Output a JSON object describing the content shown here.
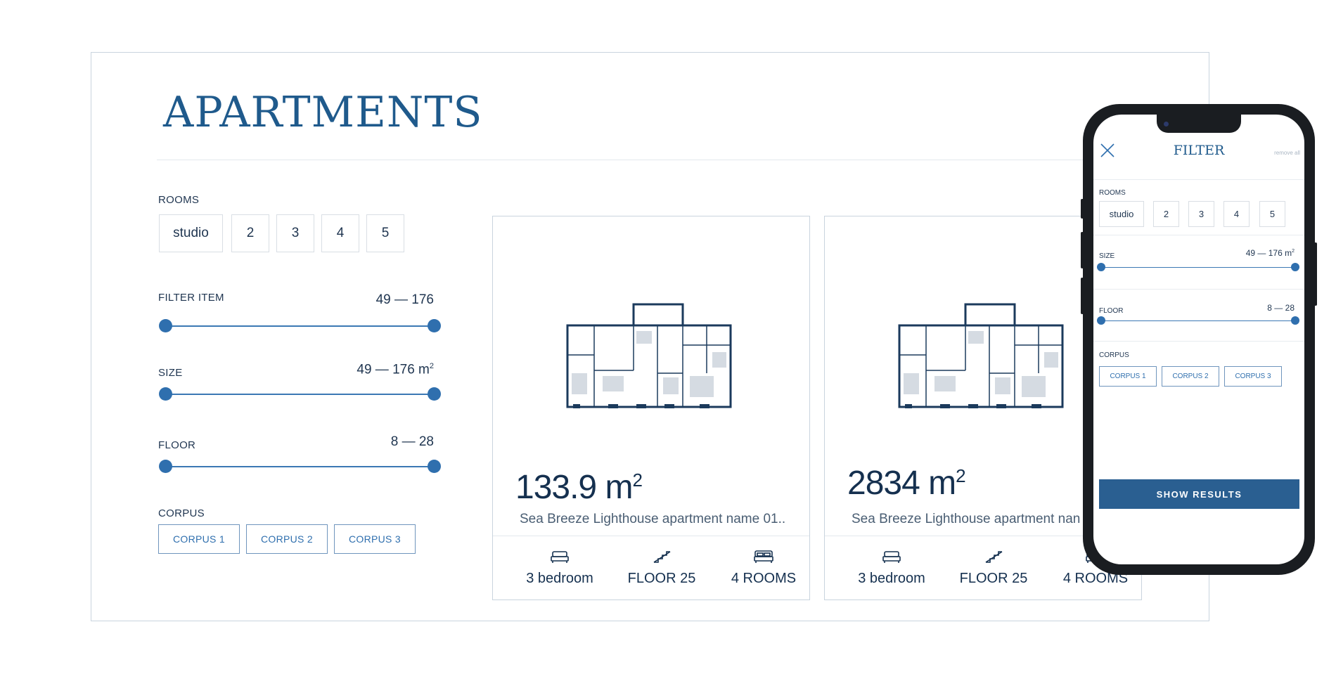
{
  "page": {
    "title": "APARTMENTS"
  },
  "filters": {
    "rooms": {
      "label": "ROOMS",
      "options": [
        "studio",
        "2",
        "3",
        "4",
        "5"
      ]
    },
    "filter_item": {
      "label": "FILTER ITEM",
      "value": "49 — 176",
      "min": 49,
      "max": 176
    },
    "size": {
      "label": "SIZE",
      "value": "49 — 176 m",
      "unit_sup": "2",
      "min": 49,
      "max": 176
    },
    "floor": {
      "label": "FLOOR",
      "value": "8 — 28",
      "min": 8,
      "max": 28
    },
    "corpus": {
      "label": "CORPUS",
      "options": [
        "CORPUS 1",
        "CORPUS 2",
        "CORPUS 3"
      ]
    }
  },
  "cards": [
    {
      "area": "133.9 m",
      "area_sup": "2",
      "name": "Sea Breeze Lighthouse apartment name 01..",
      "features": [
        {
          "icon": "bed-icon",
          "text": "3 bedroom"
        },
        {
          "icon": "stairs-icon",
          "text": "FLOOR 25"
        },
        {
          "icon": "double-bed-icon",
          "text": "4 ROOMS"
        }
      ]
    },
    {
      "area": "2834 m",
      "area_sup": "2",
      "name": "Sea Breeze Lighthouse apartment nan",
      "features": [
        {
          "icon": "bed-icon",
          "text": "3 bedroom"
        },
        {
          "icon": "stairs-icon",
          "text": "FLOOR 25"
        },
        {
          "icon": "double-bed-icon",
          "text": "4 ROOMS"
        }
      ]
    }
  ],
  "mobile": {
    "title": "FILTER",
    "remove_all": "remove all",
    "rooms": {
      "label": "ROOMS",
      "options": [
        "studio",
        "2",
        "3",
        "4",
        "5"
      ]
    },
    "size": {
      "label": "SIZE",
      "value": "49 — 176 m",
      "unit_sup": "2"
    },
    "floor": {
      "label": "FLOOR",
      "value": "8 — 28"
    },
    "corpus": {
      "label": "CORPUS",
      "options": [
        "CORPUS 1",
        "CORPUS 2",
        "CORPUS 3"
      ]
    },
    "show_results": "SHOW RESULTS"
  },
  "colors": {
    "accent": "#2f6fae",
    "title": "#1f5a8c",
    "text": "#1f3550",
    "button": "#2a5f91"
  }
}
